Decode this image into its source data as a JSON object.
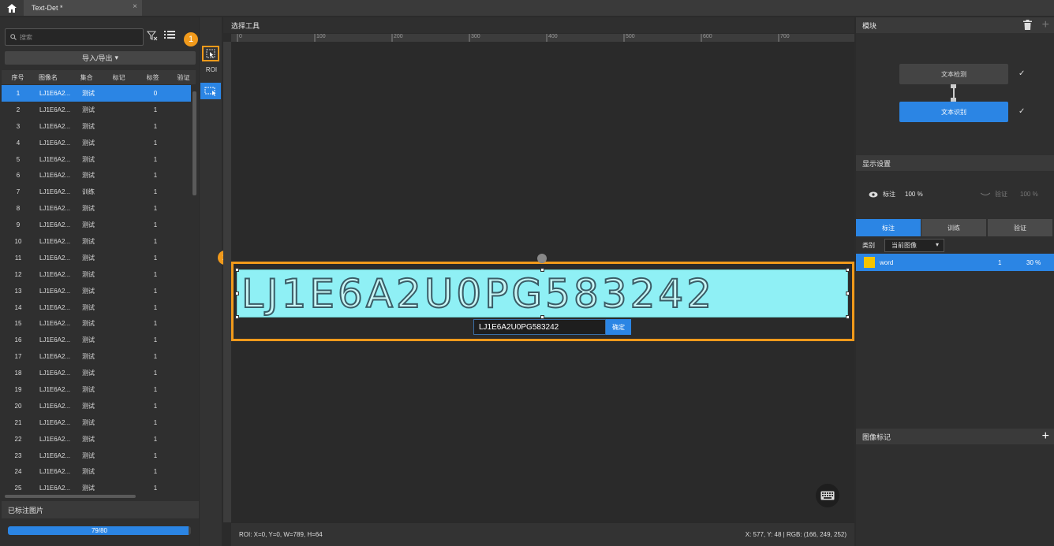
{
  "window": {
    "tab_title": "Text-Det *",
    "tab_close": "×"
  },
  "left": {
    "search_placeholder": "搜索",
    "import_export": "导入/导出",
    "columns": [
      "序号",
      "图像名",
      "集合",
      "标记",
      "标签",
      "验证"
    ],
    "rows": [
      {
        "no": "1",
        "name": "LJ1E6A2...",
        "set": "测试",
        "tag": "0"
      },
      {
        "no": "2",
        "name": "LJ1E6A2...",
        "set": "测试",
        "tag": "1"
      },
      {
        "no": "3",
        "name": "LJ1E6A2...",
        "set": "测试",
        "tag": "1"
      },
      {
        "no": "4",
        "name": "LJ1E6A2...",
        "set": "测试",
        "tag": "1"
      },
      {
        "no": "5",
        "name": "LJ1E6A2...",
        "set": "测试",
        "tag": "1"
      },
      {
        "no": "6",
        "name": "LJ1E6A2...",
        "set": "测试",
        "tag": "1"
      },
      {
        "no": "7",
        "name": "LJ1E6A2...",
        "set": "训练",
        "tag": "1"
      },
      {
        "no": "8",
        "name": "LJ1E6A2...",
        "set": "测试",
        "tag": "1"
      },
      {
        "no": "9",
        "name": "LJ1E6A2...",
        "set": "测试",
        "tag": "1"
      },
      {
        "no": "10",
        "name": "LJ1E6A2...",
        "set": "测试",
        "tag": "1"
      },
      {
        "no": "11",
        "name": "LJ1E6A2...",
        "set": "测试",
        "tag": "1"
      },
      {
        "no": "12",
        "name": "LJ1E6A2...",
        "set": "测试",
        "tag": "1"
      },
      {
        "no": "13",
        "name": "LJ1E6A2...",
        "set": "测试",
        "tag": "1"
      },
      {
        "no": "14",
        "name": "LJ1E6A2...",
        "set": "测试",
        "tag": "1"
      },
      {
        "no": "15",
        "name": "LJ1E6A2...",
        "set": "测试",
        "tag": "1"
      },
      {
        "no": "16",
        "name": "LJ1E6A2...",
        "set": "测试",
        "tag": "1"
      },
      {
        "no": "17",
        "name": "LJ1E6A2...",
        "set": "测试",
        "tag": "1"
      },
      {
        "no": "18",
        "name": "LJ1E6A2...",
        "set": "测试",
        "tag": "1"
      },
      {
        "no": "19",
        "name": "LJ1E6A2...",
        "set": "测试",
        "tag": "1"
      },
      {
        "no": "20",
        "name": "LJ1E6A2...",
        "set": "测试",
        "tag": "1"
      },
      {
        "no": "21",
        "name": "LJ1E6A2...",
        "set": "测试",
        "tag": "1"
      },
      {
        "no": "22",
        "name": "LJ1E6A2...",
        "set": "测试",
        "tag": "1"
      },
      {
        "no": "23",
        "name": "LJ1E6A2...",
        "set": "测试",
        "tag": "1"
      },
      {
        "no": "24",
        "name": "LJ1E6A2...",
        "set": "测试",
        "tag": "1"
      },
      {
        "no": "25",
        "name": "LJ1E6A2...",
        "set": "测试",
        "tag": "1"
      }
    ],
    "annotated_header": "已标注图片",
    "progress_text": "79/80",
    "progress_fraction": 0.9875
  },
  "tools": {
    "roi_label": "ROI",
    "marker1": "1",
    "marker2": "2"
  },
  "center": {
    "header": "选择工具",
    "ruler_labels": [
      "0",
      "100",
      "200",
      "300",
      "400",
      "500",
      "600",
      "700"
    ],
    "image_text": "LJ1E6A2U0PG583242",
    "input_value": "LJ1E6A2U0PG583242",
    "confirm": "确定",
    "status_left": "ROI: X=0, Y=0, W=789, H=64",
    "status_right": "X: 577, Y: 48 | RGB: (166, 249, 252)"
  },
  "right": {
    "module_header": "模块",
    "node1": "文本检测",
    "node2": "文本识别",
    "check": "✓",
    "display_header": "显示设置",
    "label_name": "标注",
    "label_pct": "100 %",
    "verify_name": "验证",
    "verify_pct": "100 %",
    "tabs": [
      "标注",
      "训练",
      "验证"
    ],
    "category_label": "类别",
    "category_value": "当前图像",
    "class_name": "word",
    "class_count": "1",
    "class_pct": "30 %",
    "image_mark_header": "图像标记",
    "plus": "+"
  },
  "colors": {
    "accent": "#2b85e4",
    "highlight": "#f19a1b",
    "class_color": "#f5c400"
  }
}
